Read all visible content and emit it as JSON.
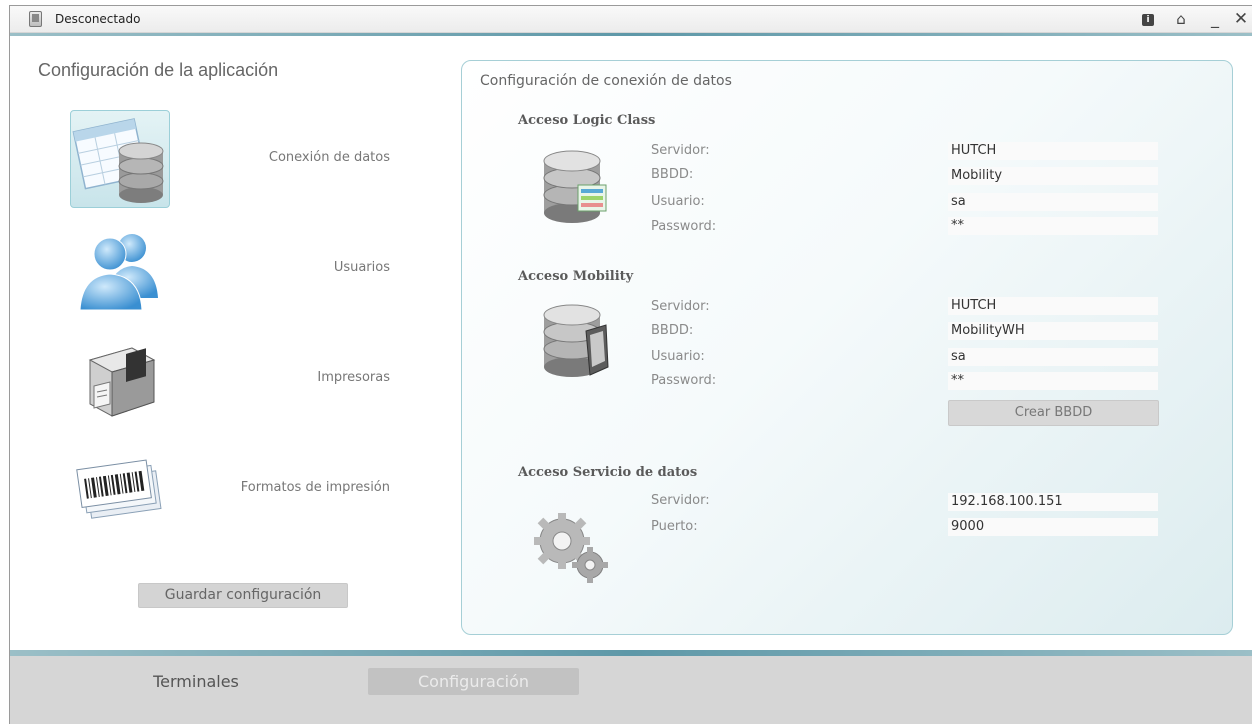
{
  "window": {
    "title": "Desconectado"
  },
  "app": {
    "title": "Configuración de la aplicación"
  },
  "nav": [
    {
      "label": "Conexión de datos",
      "icon": "database-table-icon"
    },
    {
      "label": "Usuarios",
      "icon": "users-icon"
    },
    {
      "label": "Impresoras",
      "icon": "printer-icon"
    },
    {
      "label": "Formatos de impresión",
      "icon": "barcode-labels-icon"
    }
  ],
  "save_label": "Guardar configuración",
  "panel": {
    "title": "Configuración de conexión de datos",
    "logic_class": {
      "title": "Acceso Logic Class",
      "servidor_label": "Servidor:",
      "servidor": "HUTCH",
      "bbdd_label": "BBDD:",
      "bbdd": "Mobility",
      "usuario_label": "Usuario:",
      "usuario": "sa",
      "password_label": "Password:",
      "password": "**"
    },
    "mobility": {
      "title": "Acceso Mobility",
      "servidor_label": "Servidor:",
      "servidor": "HUTCH",
      "bbdd_label": "BBDD:",
      "bbdd": "MobilityWH",
      "usuario_label": "Usuario:",
      "usuario": "sa",
      "password_label": "Password:",
      "password": "**",
      "create_label": "Crear BBDD"
    },
    "servicio": {
      "title": "Acceso Servicio de datos",
      "servidor_label": "Servidor:",
      "servidor": "192.168.100.151",
      "puerto_label": "Puerto:",
      "puerto": "9000"
    }
  },
  "tabs": {
    "terminales": "Terminales",
    "configuracion": "Configuración"
  },
  "colors": {
    "accent": "#5e98a8",
    "panel_border": "#a6cfd6",
    "button_bg": "#d4d4d4"
  }
}
